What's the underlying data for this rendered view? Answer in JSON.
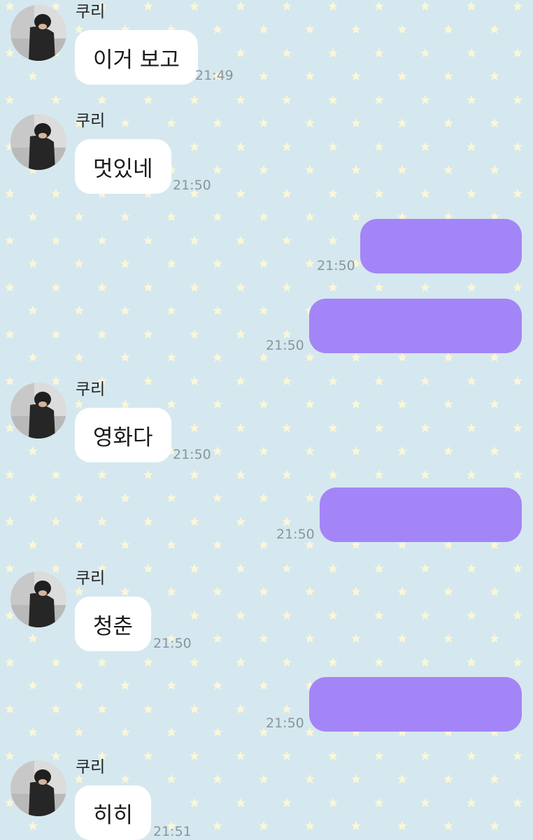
{
  "colors": {
    "background": "#d5e8ef",
    "star": "#fbf6d8",
    "bubble_in": "#ffffff",
    "bubble_out": "#a485f7",
    "time_text": "#8a959b"
  },
  "messages": [
    {
      "direction": "in",
      "sender": "쿠리",
      "text": "이거 보고",
      "time": "21:49",
      "avatar_icon": "profile-photo"
    },
    {
      "direction": "in",
      "sender": "쿠리",
      "text": "멋있네",
      "time": "21:50",
      "avatar_icon": "profile-photo"
    },
    {
      "direction": "out",
      "time": "21:50"
    },
    {
      "direction": "out",
      "time": "21:50"
    },
    {
      "direction": "in",
      "sender": "쿠리",
      "text": "영화다",
      "time": "21:50",
      "avatar_icon": "profile-photo"
    },
    {
      "direction": "out",
      "time": "21:50"
    },
    {
      "direction": "in",
      "sender": "쿠리",
      "text": "청춘",
      "time": "21:50",
      "avatar_icon": "profile-photo"
    },
    {
      "direction": "out",
      "time": "21:50"
    },
    {
      "direction": "in",
      "sender": "쿠리",
      "text": "히히",
      "time": "21:51",
      "avatar_icon": "profile-photo"
    }
  ]
}
